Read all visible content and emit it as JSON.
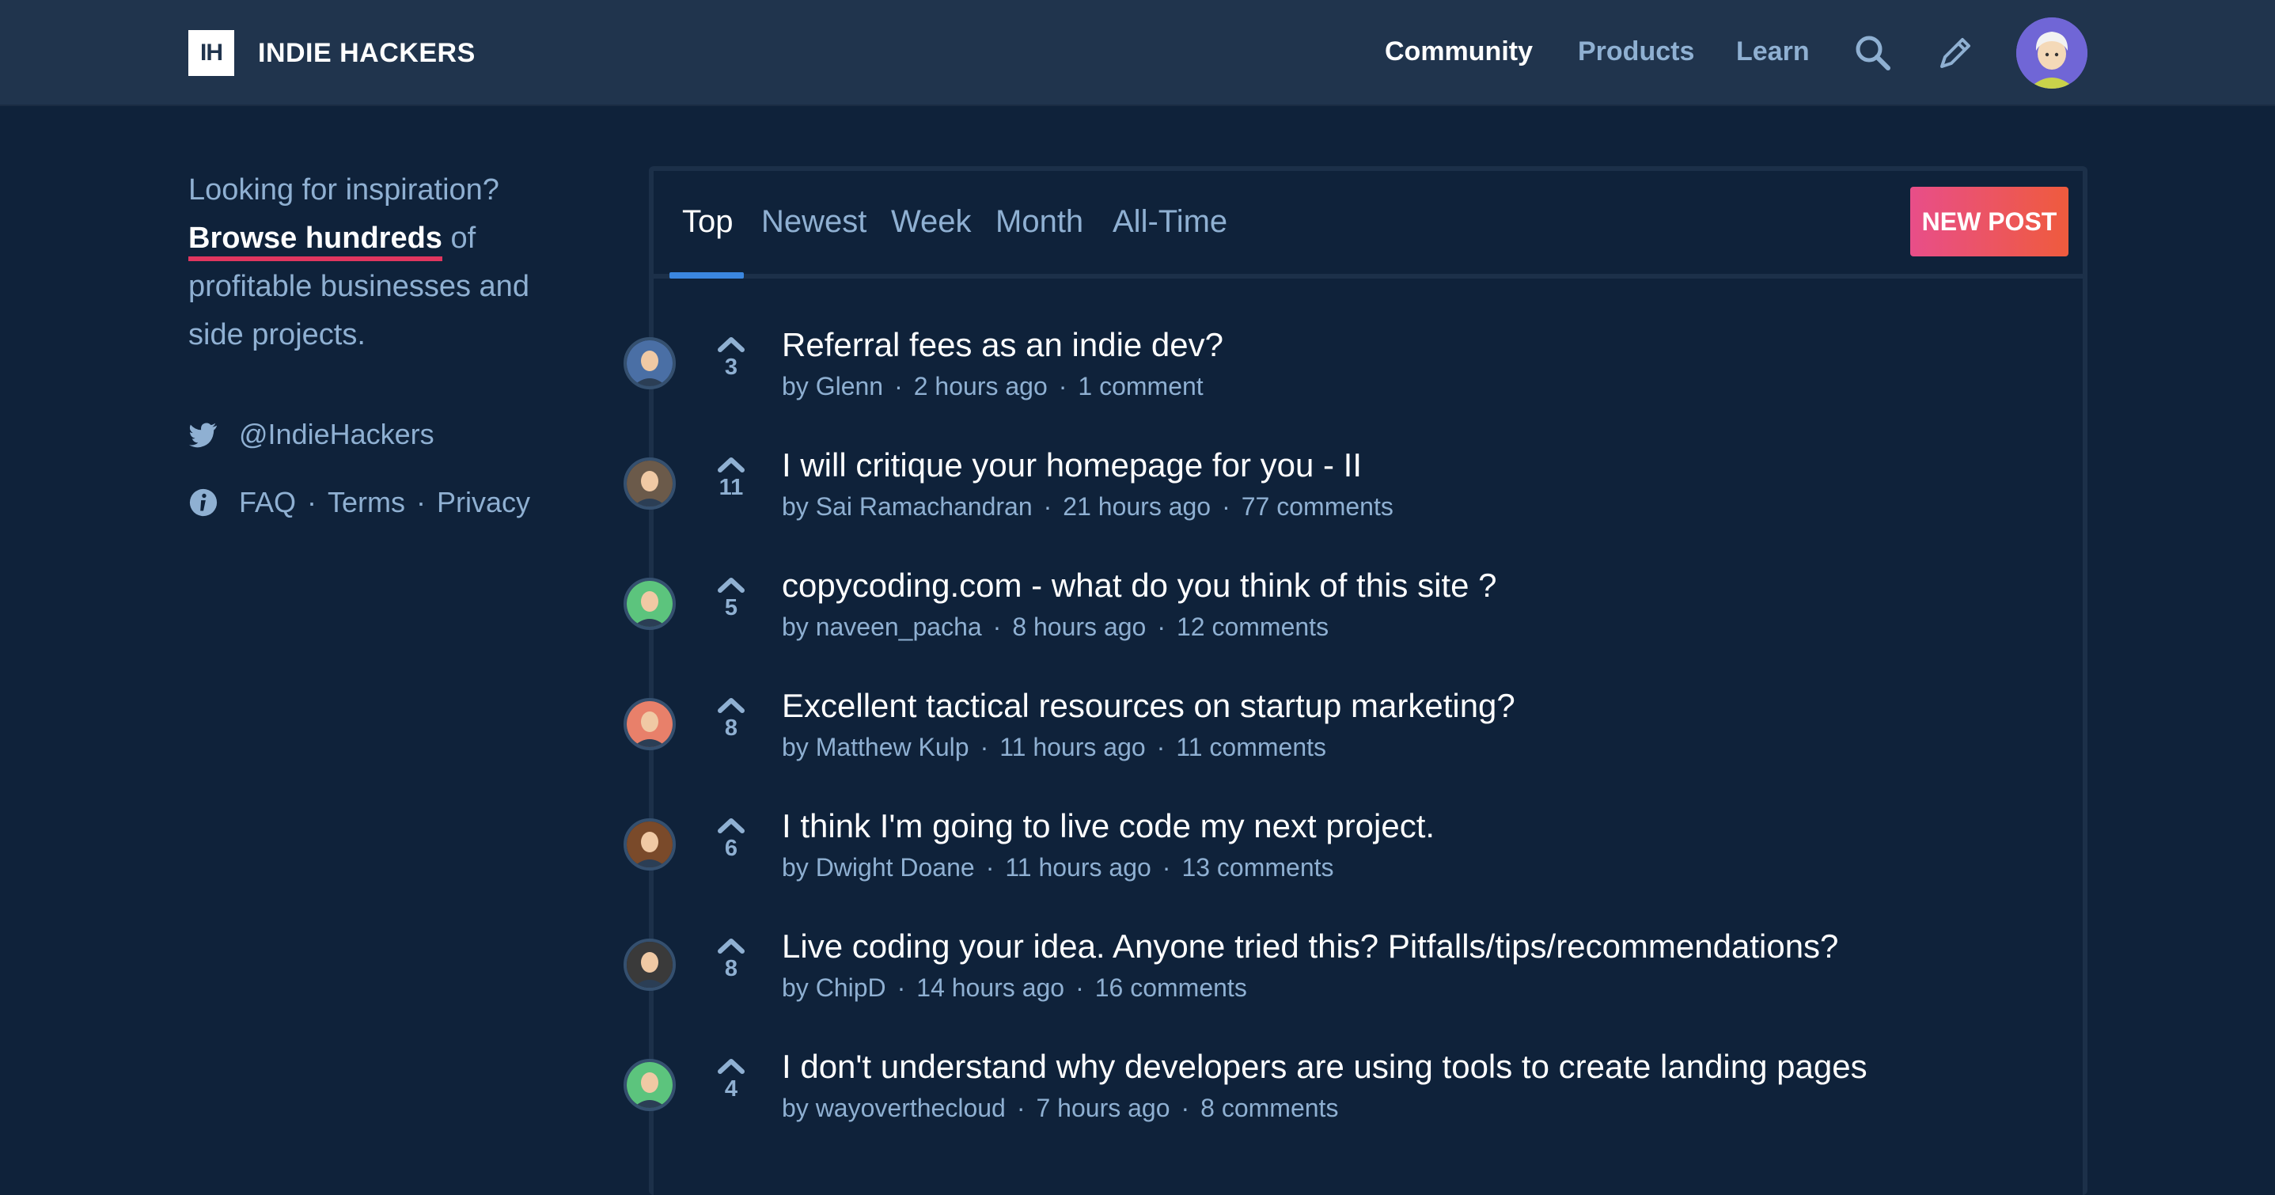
{
  "header": {
    "logo_mark": "IH",
    "logo_text": "INDIE HACKERS",
    "nav": [
      {
        "label": "Community",
        "active": true
      },
      {
        "label": "Products",
        "active": false
      },
      {
        "label": "Learn",
        "active": false
      }
    ],
    "icons": [
      "search-icon",
      "pencil-icon",
      "user-avatar"
    ]
  },
  "sidebar": {
    "line1": "Looking for inspiration?",
    "browse_link": "Browse hundreds",
    "line2_rest": " of",
    "line3": "profitable businesses and",
    "line4": "side projects.",
    "twitter": "@IndieHackers",
    "faq": "FAQ",
    "terms": "Terms",
    "privacy": "Privacy",
    "sep": "·"
  },
  "feed": {
    "tabs": [
      {
        "label": "Top",
        "active": true
      },
      {
        "label": "Newest",
        "active": false
      },
      {
        "label": "Week",
        "active": false
      },
      {
        "label": "Month",
        "active": false
      },
      {
        "label": "All-Time",
        "active": false
      }
    ],
    "new_post_label": "NEW POST",
    "posts": [
      {
        "title": "Referral fees as an indie dev?",
        "votes": "3",
        "by": "by",
        "author": "Glenn",
        "time": "2 hours ago",
        "comments": "1 comment",
        "avatar_color": "#4a6fa5"
      },
      {
        "title": "I will critique your homepage for you - II",
        "votes": "11",
        "by": "by",
        "author": "Sai Ramachandran",
        "time": "21 hours ago",
        "comments": "77 comments",
        "avatar_color": "#6b5a4a"
      },
      {
        "title": "copycoding.com - what do you think of this site ?",
        "votes": "5",
        "by": "by",
        "author": "naveen_pacha",
        "time": "8 hours ago",
        "comments": "12 comments",
        "avatar_color": "#5cc47d"
      },
      {
        "title": "Excellent tactical resources on startup marketing?",
        "votes": "8",
        "by": "by",
        "author": "Matthew Kulp",
        "time": "11 hours ago",
        "comments": "11 comments",
        "avatar_color": "#e8806a"
      },
      {
        "title": "I think I'm going to live code my next project.",
        "votes": "6",
        "by": "by",
        "author": "Dwight Doane",
        "time": "11 hours ago",
        "comments": "13 comments",
        "avatar_color": "#7a4a2a"
      },
      {
        "title": "Live coding your idea. Anyone tried this? Pitfalls/tips/recommendations?",
        "votes": "8",
        "by": "by",
        "author": "ChipD",
        "time": "14 hours ago",
        "comments": "16 comments",
        "avatar_color": "#3a3a3a"
      },
      {
        "title": "I don't understand why developers are using tools to create landing pages",
        "votes": "4",
        "by": "by",
        "author": "wayoverthecloud",
        "time": "7 hours ago",
        "comments": "8 comments",
        "avatar_color": "#5cc47d"
      }
    ]
  },
  "colors": {
    "background": "#0f223a",
    "header": "#20344d",
    "accent_blue": "#3b87e0",
    "muted_text": "#8fb0d2",
    "new_post_gradient": [
      "#e84e89",
      "#ef5b3d"
    ],
    "browse_underline": "#e0365f"
  }
}
